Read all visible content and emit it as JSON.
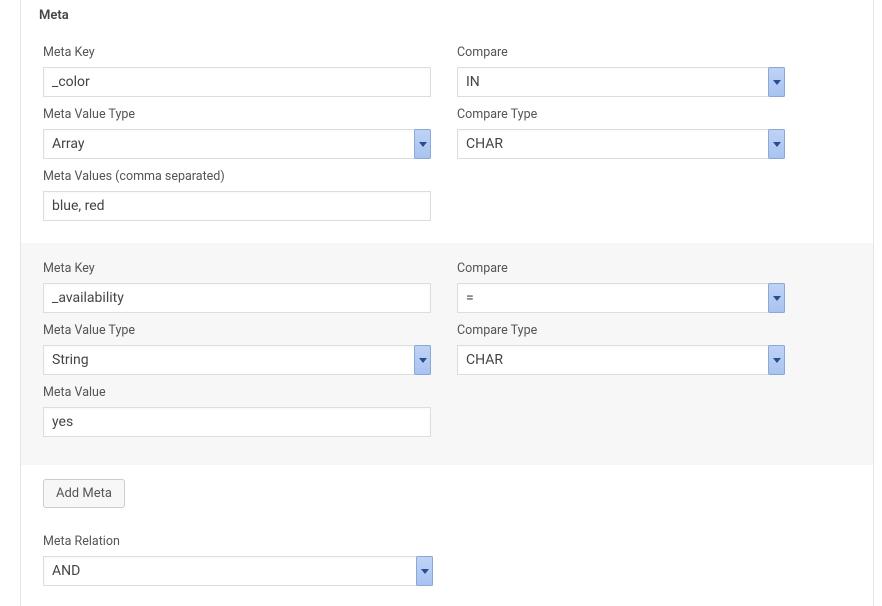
{
  "section": {
    "title": "Meta"
  },
  "labels": {
    "meta_key": "Meta Key",
    "compare": "Compare",
    "meta_value_type": "Meta Value Type",
    "compare_type": "Compare Type",
    "meta_values_comma": "Meta Values (comma separated)",
    "meta_value": "Meta Value",
    "meta_relation": "Meta Relation"
  },
  "blocks": [
    {
      "meta_key": "_color",
      "compare": "IN",
      "meta_value_type": "Array",
      "compare_type": "CHAR",
      "meta_values": "blue, red"
    },
    {
      "meta_key": "_availability",
      "compare": "=",
      "meta_value_type": "String",
      "compare_type": "CHAR",
      "meta_value": "yes"
    }
  ],
  "buttons": {
    "add_meta": "Add Meta"
  },
  "meta_relation": "AND"
}
